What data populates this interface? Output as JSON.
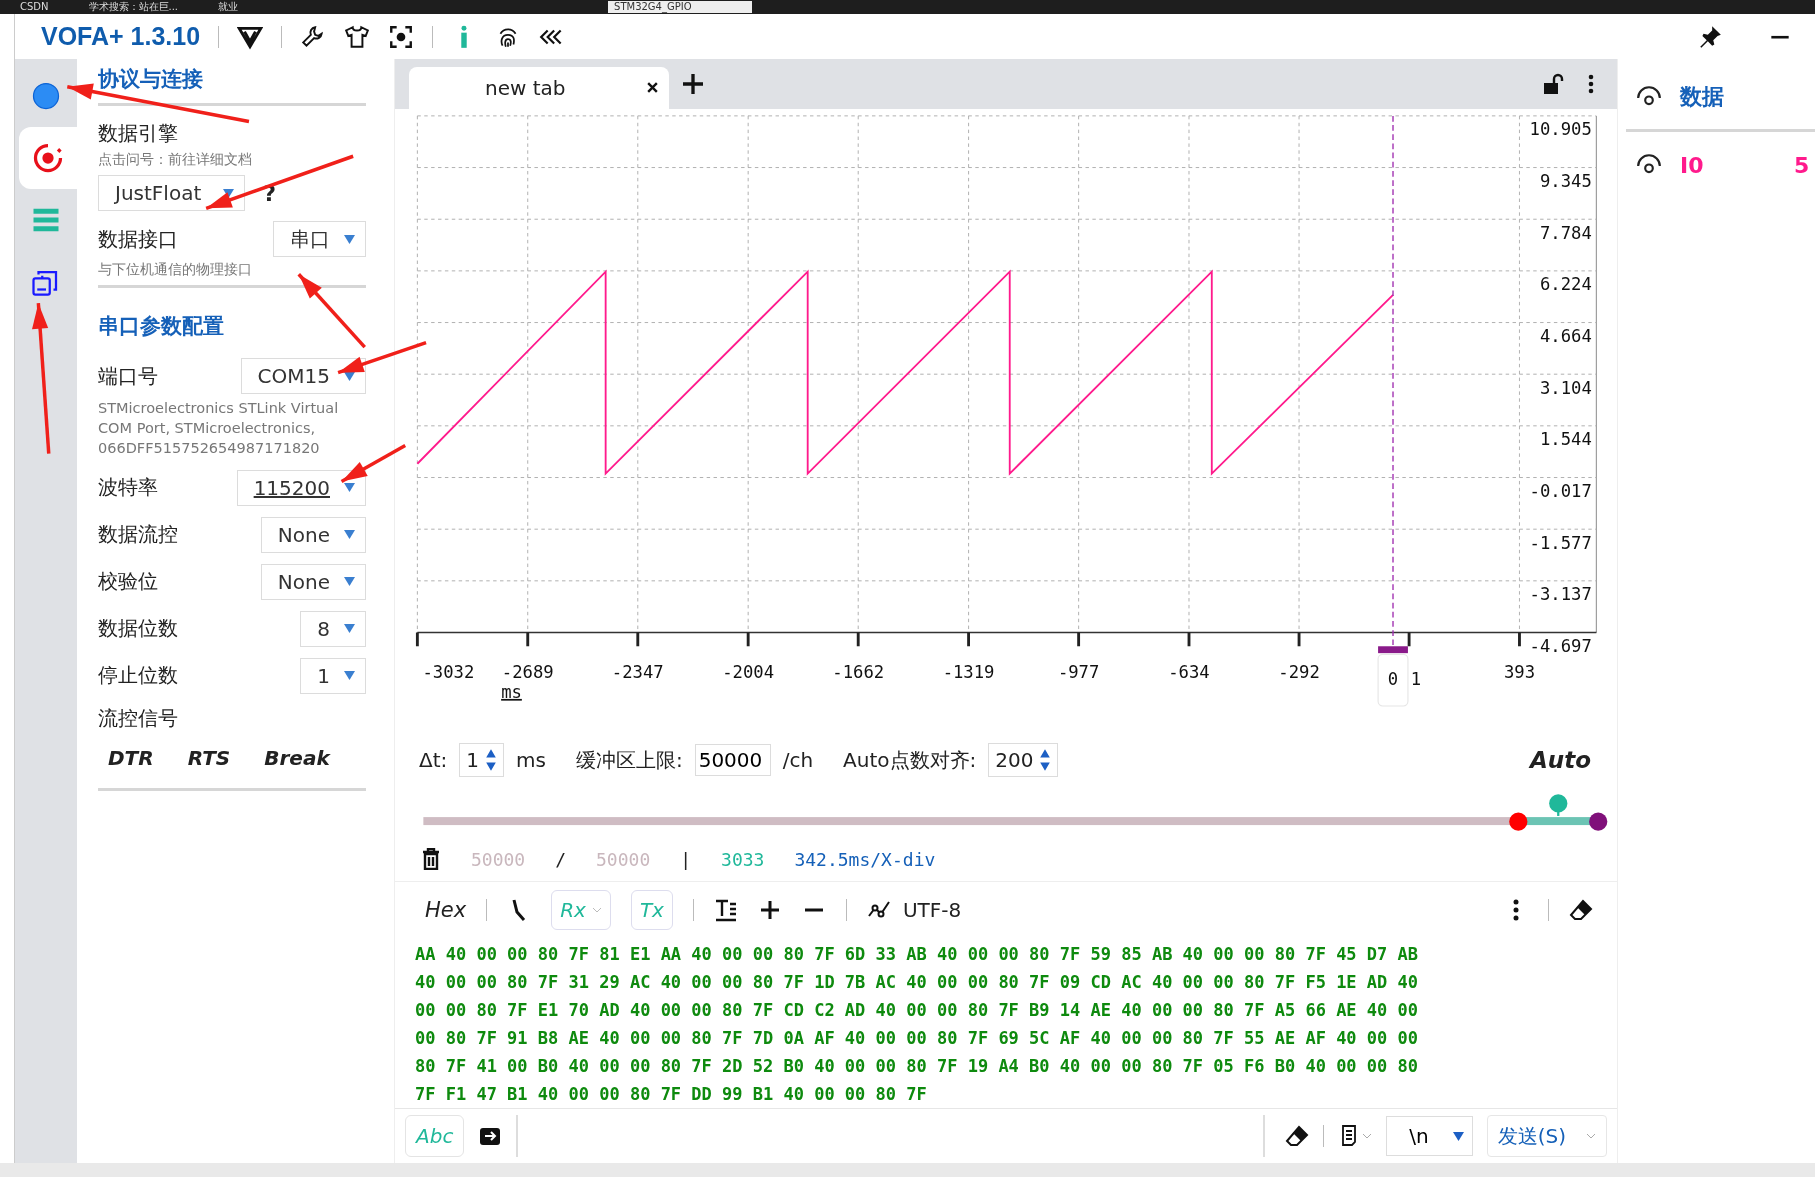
{
  "desktop": {
    "tabs": [
      {
        "label": "CSDN"
      },
      {
        "label": "学术搜索：站在巨..."
      },
      {
        "label": "就业"
      }
    ],
    "project": "STM32G4_GPIO"
  },
  "app": {
    "title": "VOFA+ 1.3.10"
  },
  "rail": [
    {
      "kind": "connect",
      "selected": false
    },
    {
      "kind": "engine",
      "selected": true
    },
    {
      "kind": "menu",
      "selected": false
    },
    {
      "kind": "windows",
      "selected": false
    }
  ],
  "config": {
    "title": "协议与连接",
    "engine": {
      "label": "数据引擎",
      "hint": "点击问号：前往详细文档",
      "value": "JustFloat",
      "help": "?"
    },
    "interface": {
      "label": "数据接口",
      "value": "串口",
      "hint": "与下位机通信的物理接口"
    },
    "serial_title": "串口参数配置",
    "port": {
      "label": "端口号",
      "value": "COM15",
      "description_lines": [
        "STMicroelectronics STLink Virtual",
        "COM Port, STMicroelectronics,",
        "066DFF515752654987171820"
      ]
    },
    "params": [
      {
        "label": "波特率",
        "value": "115200",
        "underlined": true
      },
      {
        "label": "数据流控",
        "value": "None",
        "underlined": false
      },
      {
        "label": "校验位",
        "value": "None",
        "underlined": false
      },
      {
        "label": "数据位数",
        "value": "8",
        "underlined": false
      },
      {
        "label": "停止位数",
        "value": "1",
        "underlined": false
      }
    ],
    "flow_title": "流控信号",
    "flow_signals": [
      "DTR",
      "RTS",
      "Break"
    ]
  },
  "tabs": [
    {
      "label": "new tab",
      "selected": true
    }
  ],
  "chart_data": {
    "type": "line",
    "xlabel": "ms",
    "xlim": [
      -3032,
      632
    ],
    "ylim": [
      -4.697,
      10.905
    ],
    "xticks": [
      -3032,
      -2689,
      -2347,
      -2004,
      -1662,
      -1319,
      -977,
      -634,
      -292,
      393
    ],
    "yticks": [
      10.905,
      9.345,
      7.784,
      6.224,
      4.664,
      3.104,
      1.544,
      -0.017,
      -1.577,
      -3.137,
      -4.697
    ],
    "grid": true,
    "ref_lines": [
      {
        "axis": "x",
        "value": 0,
        "label": "0"
      }
    ],
    "series": [
      {
        "color": "#ff1a8c",
        "x": [
          -3032,
          -2447,
          -2447,
          -1819,
          -1819,
          -1191,
          -1191,
          -563,
          -563,
          0
        ],
        "values": [
          0.4,
          6.2,
          0.1,
          6.2,
          0.1,
          6.2,
          0.1,
          6.2,
          0.1,
          5.5
        ]
      }
    ]
  },
  "cursor": {
    "tick_label": "1"
  },
  "controls": {
    "dt_label": "Δt:",
    "dt": "1",
    "dt_unit": "ms",
    "buffer_label": "缓冲区上限:",
    "buffer": "50000",
    "buffer_unit": "/ch",
    "align_label": "Auto点数对齐:",
    "align": "200",
    "mode": "Auto"
  },
  "window_slider": {
    "level": 0.932
  },
  "stats": {
    "count": "50000",
    "sep": "/",
    "capacity": "50000",
    "divider": "|",
    "points": "3033",
    "scale": "342.5ms/X-div"
  },
  "hex_toolbar": {
    "format": "Hex",
    "rx": {
      "label": "Rx",
      "on": true
    },
    "tx": {
      "label": "Tx",
      "on": true
    },
    "encoding": "UTF-8"
  },
  "hex_lines": [
    "AA 40 00 00 80 7F 81 E1 AA 40 00 00 80 7F 6D 33 AB 40 00 00 80 7F 59 85 AB 40 00 00 80 7F 45 D7 AB",
    "40 00 00 80 7F 31 29 AC 40 00 00 80 7F 1D 7B AC 40 00 00 80 7F 09 CD AC 40 00 00 80 7F F5 1E AD 40",
    "00 00 80 7F E1 70 AD 40 00 00 80 7F CD C2 AD 40 00 00 80 7F B9 14 AE 40 00 00 80 7F A5 66 AE 40 00",
    "00 80 7F 91 B8 AE 40 00 00 80 7F 7D 0A AF 40 00 00 80 7F 69 5C AF 40 00 00 80 7F 55 AE AF 40 00 00",
    "80 7F 41 00 B0 40 00 00 80 7F 2D 52 B0 40 00 00 80 7F 19 A4 B0 40 00 00 80 7F 05 F6 B0 40 00 00 80",
    "7F F1 47 B1 40 00 00 80 7F DD 99 B1 40 00 00 80 7F"
  ],
  "send_bar": {
    "mode": "Abc",
    "line_ending": "\\n",
    "send": "发送(S)"
  },
  "sidebar": {
    "title": "数据",
    "channels": [
      {
        "name": "I0",
        "value": "5",
        "color": "#ff1a8c"
      }
    ]
  }
}
